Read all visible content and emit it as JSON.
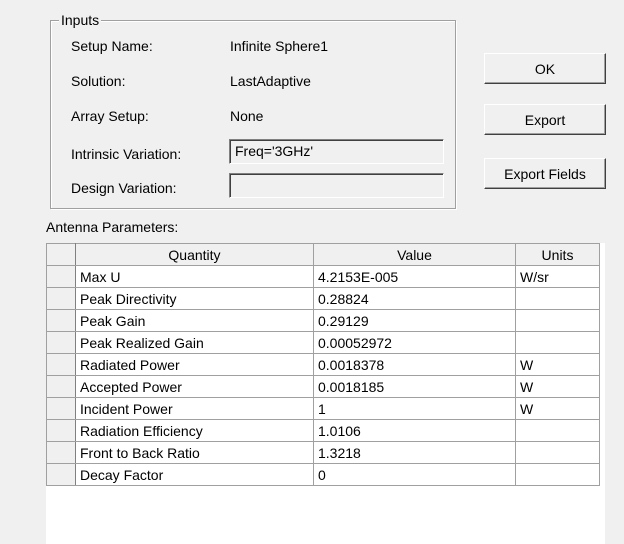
{
  "inputs": {
    "group_title": "Inputs",
    "setup_name_label": "Setup Name:",
    "setup_name_value": "Infinite Sphere1",
    "solution_label": "Solution:",
    "solution_value": "LastAdaptive",
    "array_setup_label": "Array Setup:",
    "array_setup_value": "None",
    "intrinsic_variation_label": "Intrinsic Variation:",
    "intrinsic_variation_value": "Freq='3GHz'",
    "design_variation_label": "Design Variation:",
    "design_variation_value": ""
  },
  "buttons": {
    "ok": "OK",
    "export": "Export",
    "export_fields": "Export Fields"
  },
  "antenna_parameters": {
    "label": "Antenna Parameters:",
    "columns": [
      "Quantity",
      "Value",
      "Units"
    ],
    "rows": [
      {
        "quantity": "Max U",
        "value": "4.2153E-005",
        "units": "W/sr"
      },
      {
        "quantity": "Peak Directivity",
        "value": "0.28824",
        "units": ""
      },
      {
        "quantity": "Peak Gain",
        "value": "0.29129",
        "units": ""
      },
      {
        "quantity": "Peak Realized Gain",
        "value": "0.00052972",
        "units": ""
      },
      {
        "quantity": "Radiated Power",
        "value": "0.0018378",
        "units": "W"
      },
      {
        "quantity": "Accepted Power",
        "value": "0.0018185",
        "units": "W"
      },
      {
        "quantity": "Incident Power",
        "value": "1",
        "units": "W"
      },
      {
        "quantity": "Radiation Efficiency",
        "value": "1.0106",
        "units": ""
      },
      {
        "quantity": "Front to Back Ratio",
        "value": "1.3218",
        "units": ""
      },
      {
        "quantity": "Decay Factor",
        "value": "0",
        "units": ""
      }
    ]
  }
}
